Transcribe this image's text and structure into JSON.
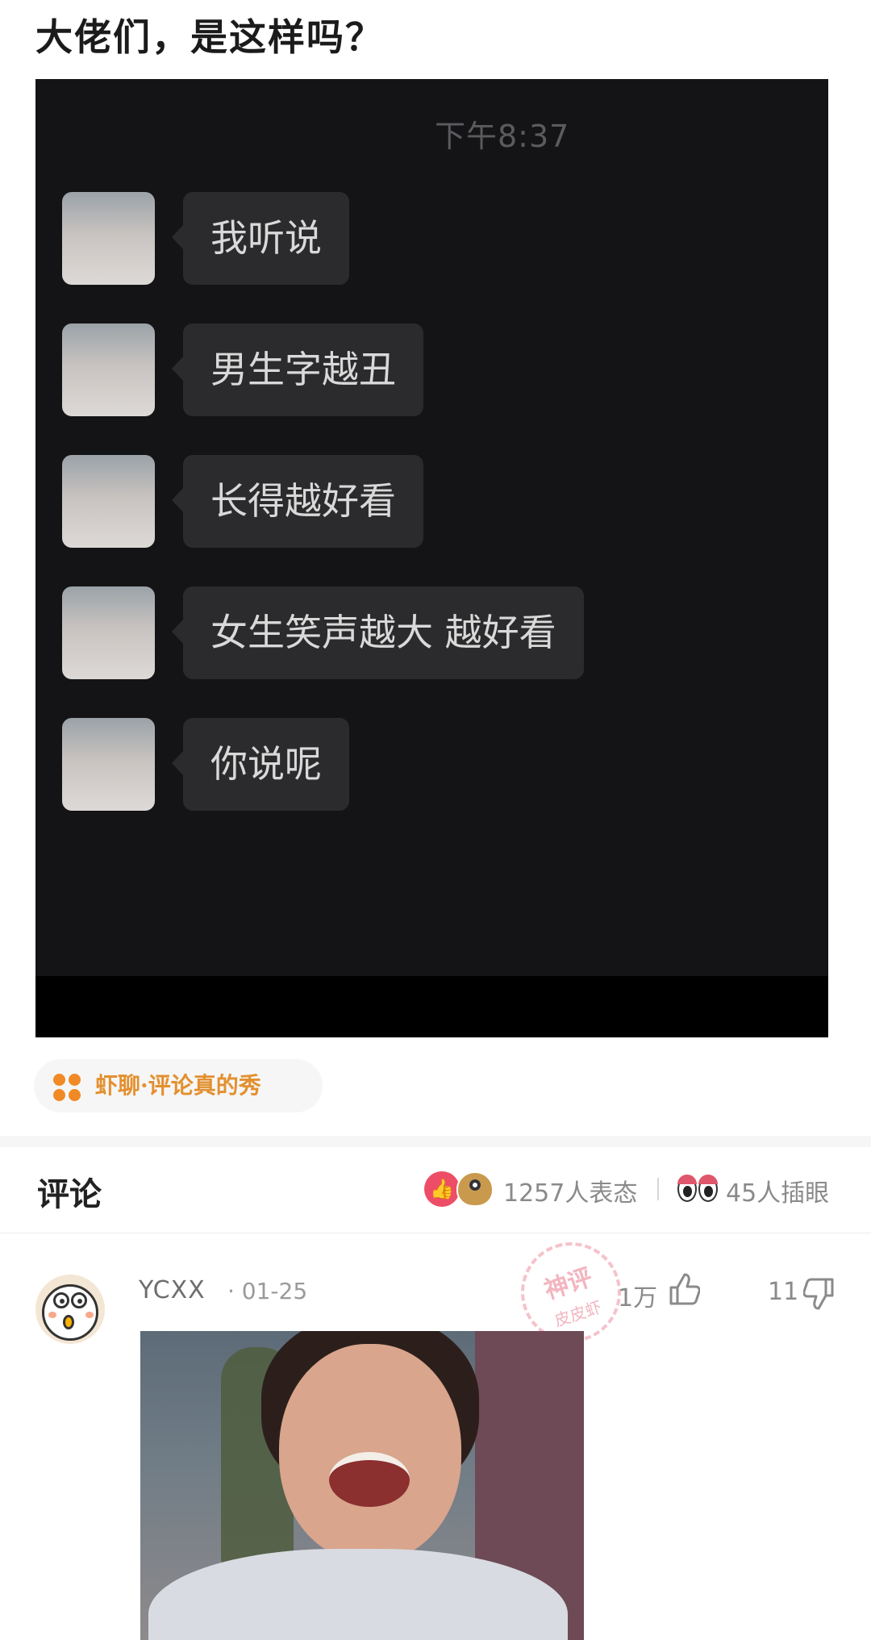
{
  "post": {
    "title": "大佬们，是这样吗？"
  },
  "chat_screenshot": {
    "time": "下午8:37",
    "messages": [
      "我听说",
      "男生字越丑",
      "长得越好看",
      "女生笑声越大 越好看",
      "你说呢"
    ]
  },
  "topic_tag": {
    "label": "虾聊·评论真的秀",
    "icon": "grid-dots-icon",
    "color": "#f08a26"
  },
  "comments_header": {
    "title": "评论",
    "reactions_text": "1257人表态",
    "peek_text": "45人插眼",
    "accent": "#ee4d67"
  },
  "comment": {
    "author": "YCXX",
    "date": "· 01-25",
    "stamp_top": "神评",
    "stamp_bottom": "皮皮虾",
    "like_count": "1万",
    "dislike_count": "11"
  }
}
